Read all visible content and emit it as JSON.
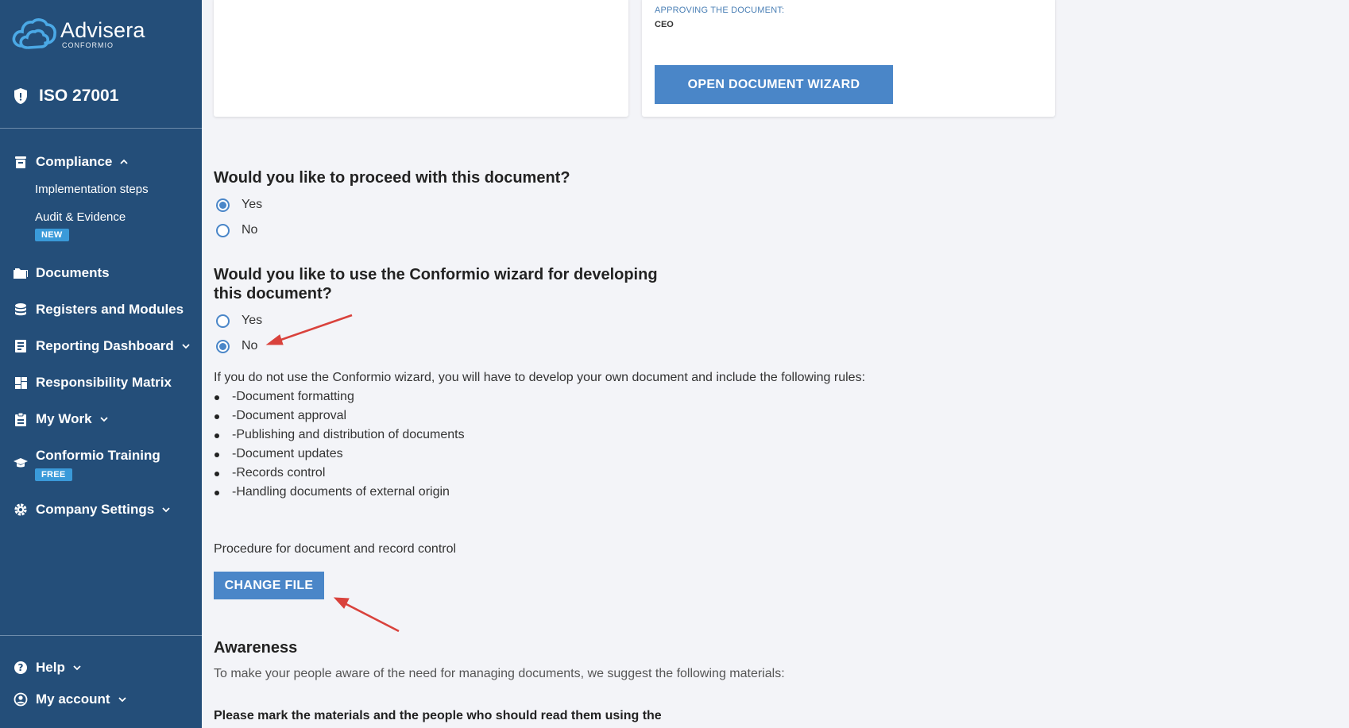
{
  "brand": {
    "name": "Advisera",
    "sub": "CONFORMIO",
    "color": "#244e79",
    "accent": "#4a86c8"
  },
  "product": {
    "name": "ISO 27001",
    "icon": "shield-icon"
  },
  "nav": {
    "compliance": {
      "label": "Compliance",
      "icon": "archive-box-icon",
      "expanded": true,
      "items": [
        {
          "label": "Implementation steps"
        },
        {
          "label": "Audit & Evidence",
          "badge": "NEW"
        }
      ]
    },
    "documents": {
      "label": "Documents",
      "icon": "folder-icon"
    },
    "registers": {
      "label": "Registers and Modules",
      "icon": "database-icon"
    },
    "reporting": {
      "label": "Reporting Dashboard",
      "icon": "report-icon"
    },
    "responsibility": {
      "label": "Responsibility Matrix",
      "icon": "dashboard-grid-icon"
    },
    "mywork": {
      "label": "My Work",
      "icon": "clipboard-icon"
    },
    "training": {
      "label": "Conformio Training",
      "badge": "FREE",
      "icon": "graduation-cap-icon"
    },
    "settings": {
      "label": "Company Settings",
      "icon": "gear-icon"
    },
    "help": {
      "label": "Help",
      "icon": "question-circle-icon"
    },
    "account": {
      "label": "My account",
      "icon": "user-circle-icon"
    }
  },
  "document_card": {
    "approving_label": "APPROVING THE DOCUMENT:",
    "approving_value": "CEO",
    "wizard_button": "OPEN DOCUMENT WIZARD"
  },
  "q1": {
    "question": "Would you like to proceed with this document?",
    "options": [
      {
        "label": "Yes",
        "selected": true
      },
      {
        "label": "No",
        "selected": false
      }
    ]
  },
  "q2": {
    "question_line1": "Would you like to use the Conformio wizard for developing",
    "question_line2": "this document?",
    "options": [
      {
        "label": "Yes",
        "selected": false
      },
      {
        "label": "No",
        "selected": true
      }
    ]
  },
  "info": {
    "intro": "If you do not use the Conformio wizard, you will have to develop your own document and include the following rules:",
    "rules": [
      "-Document formatting",
      "-Document approval",
      "-Publishing and distribution of documents",
      "-Document updates",
      "-Records control",
      "-Handling documents of external origin"
    ]
  },
  "file": {
    "name": "Procedure for document and record control",
    "button": "CHANGE FILE"
  },
  "awareness": {
    "title": "Awareness",
    "text": "To make your people aware of the need for managing documents, we suggest the following materials:",
    "instruction": "Please mark the materials and the people who should read them using the"
  }
}
